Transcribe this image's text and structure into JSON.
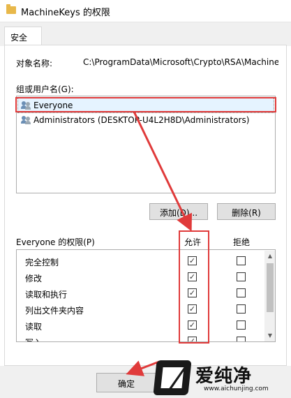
{
  "window": {
    "title": "MachineKeys 的权限"
  },
  "tabs": [
    {
      "label": "安全"
    }
  ],
  "object": {
    "label": "对象名称:",
    "value": "C:\\ProgramData\\Microsoft\\Crypto\\RSA\\MachineKeys"
  },
  "groups": {
    "label": "组或用户名(G):",
    "items": [
      {
        "name": "Everyone",
        "selected": true
      },
      {
        "name": "Administrators (DESKTOP-U4L2H8D\\Administrators)",
        "selected": false
      }
    ]
  },
  "buttons": {
    "add": "添加(D)...",
    "remove": "删除(R)",
    "ok": "确定"
  },
  "permissions": {
    "label": "Everyone 的权限(P)",
    "allow_header": "允许",
    "deny_header": "拒绝",
    "rows": [
      {
        "name": "完全控制",
        "allow": true,
        "deny": false
      },
      {
        "name": "修改",
        "allow": true,
        "deny": false
      },
      {
        "name": "读取和执行",
        "allow": true,
        "deny": false
      },
      {
        "name": "列出文件夹内容",
        "allow": true,
        "deny": false
      },
      {
        "name": "读取",
        "allow": true,
        "deny": false
      },
      {
        "name": "写入",
        "allow": true,
        "deny": false
      }
    ]
  },
  "watermark": {
    "text": "爱纯净",
    "url": "www.aichunjing.com"
  },
  "colors": {
    "highlight": "#e03a3a",
    "selection": "#e5f3ff"
  }
}
